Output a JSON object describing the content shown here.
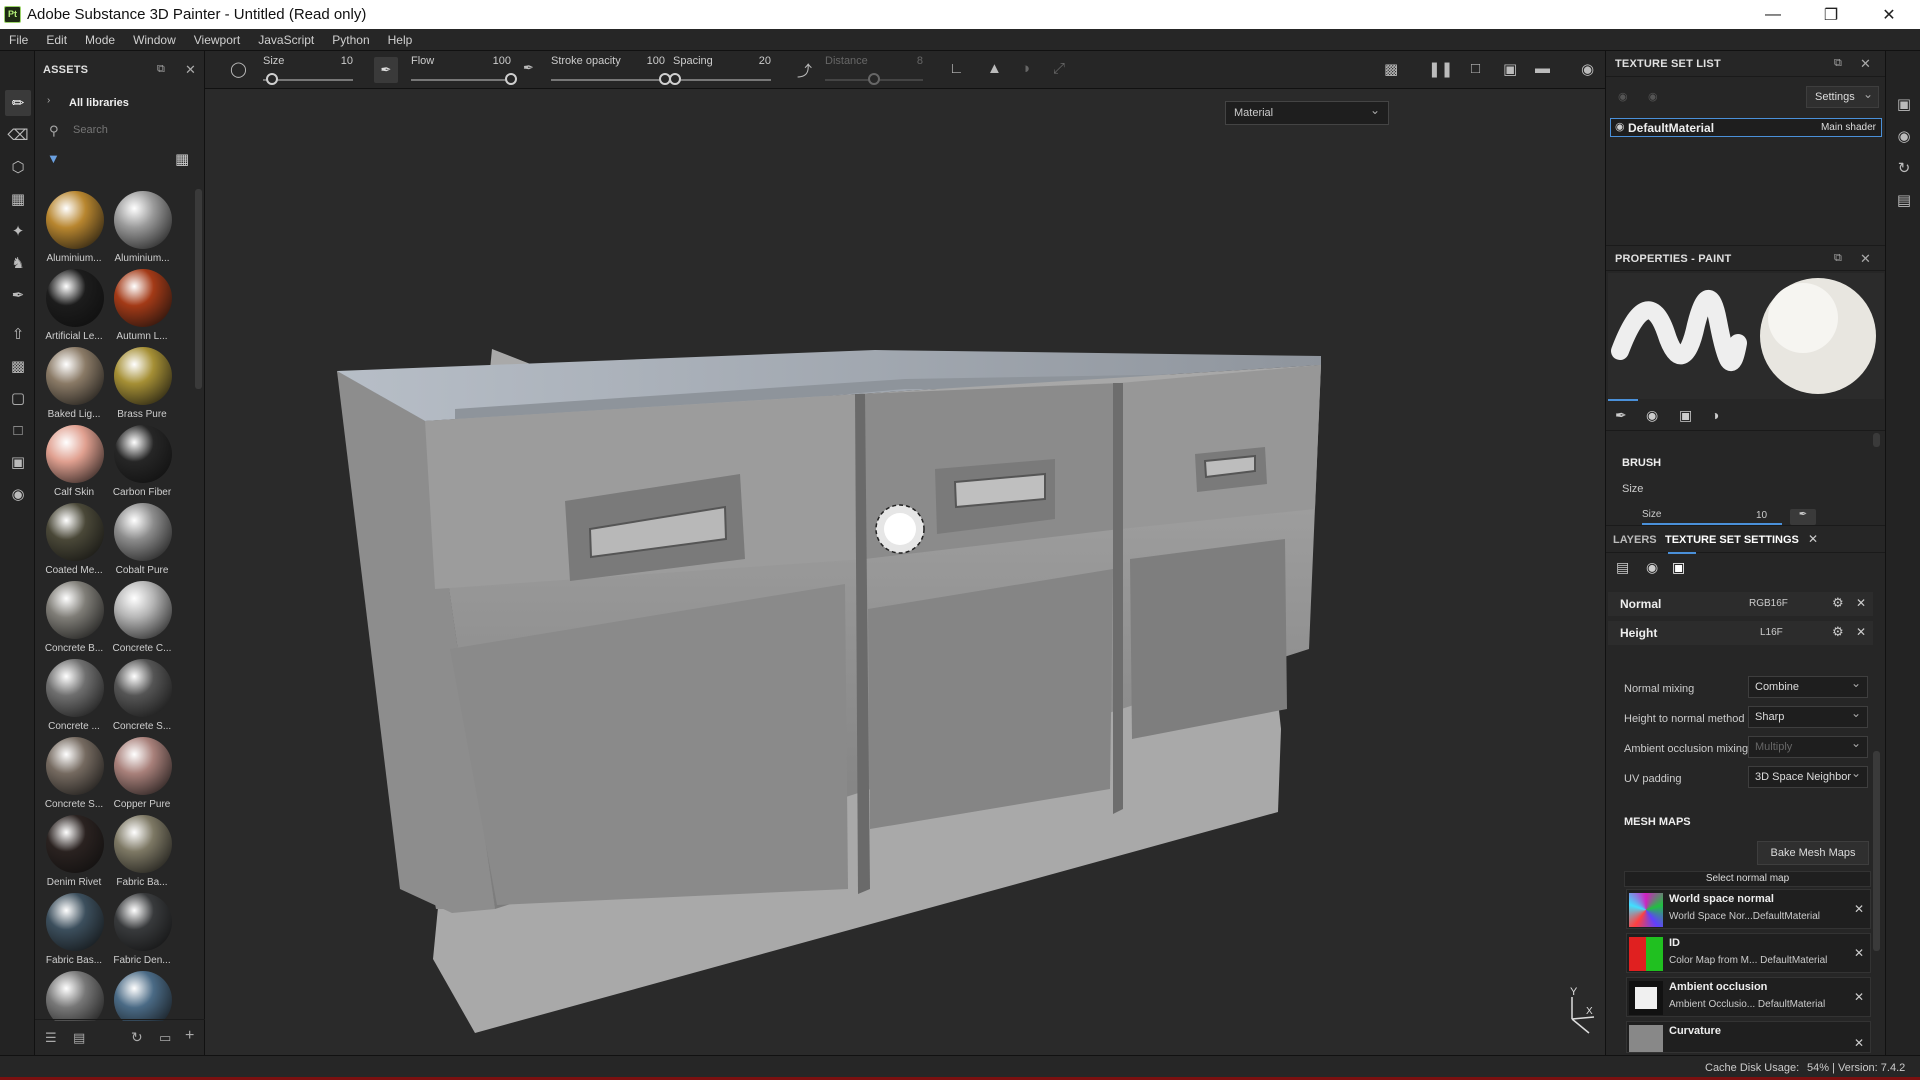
{
  "window": {
    "title": "Adobe Substance 3D Painter - Untitled (Read only)",
    "logo": "Pt"
  },
  "menu": [
    "File",
    "Edit",
    "Mode",
    "Window",
    "Viewport",
    "JavaScript",
    "Python",
    "Help"
  ],
  "tools": [
    "paint-brush",
    "eraser",
    "projection",
    "polygon-fill",
    "smudge",
    "clone",
    "color-picker",
    "bake",
    "geometry-mask",
    "quick-mask",
    "assets",
    "measure",
    "viewer-settings",
    "shelf"
  ],
  "assets_panel": {
    "title": "ASSETS",
    "libraries_label": "All libraries",
    "search_placeholder": "Search",
    "items": [
      {
        "label": "Aluminium...",
        "color": "#b8862f"
      },
      {
        "label": "Aluminium...",
        "color": "#9a9a9a"
      },
      {
        "label": "Artificial Le...",
        "color": "#1c1c1c"
      },
      {
        "label": "Autumn L...",
        "color": "#a33a17"
      },
      {
        "label": "Baked Lig...",
        "color": "#8a7a66"
      },
      {
        "label": "Brass Pure",
        "color": "#a58f35"
      },
      {
        "label": "Calf Skin",
        "color": "#e0a090"
      },
      {
        "label": "Carbon Fiber",
        "color": "#262626"
      },
      {
        "label": "Coated Me...",
        "color": "#4a4838"
      },
      {
        "label": "Cobalt Pure",
        "color": "#8c8c8c"
      },
      {
        "label": "Concrete B...",
        "color": "#7f7d77"
      },
      {
        "label": "Concrete C...",
        "color": "#b5b5b5"
      },
      {
        "label": "Concrete ...",
        "color": "#6f6f6f"
      },
      {
        "label": "Concrete S...",
        "color": "#555555"
      },
      {
        "label": "Concrete S...",
        "color": "#756a60"
      },
      {
        "label": "Copper Pure",
        "color": "#a8807a"
      },
      {
        "label": "Denim Rivet",
        "color": "#2a2220"
      },
      {
        "label": "Fabric Ba...",
        "color": "#7d7864"
      },
      {
        "label": "Fabric Bas...",
        "color": "#3c4f5d"
      },
      {
        "label": "Fabric Den...",
        "color": "#383a3c"
      },
      {
        "label": "",
        "color": "#777777"
      },
      {
        "label": "",
        "color": "#4a6a85"
      }
    ]
  },
  "toolbar": {
    "size": {
      "label": "Size",
      "value": "10",
      "fraction": 0.1
    },
    "flow": {
      "label": "Flow",
      "value": "100",
      "fraction": 1.0
    },
    "stroke_opacity": {
      "label": "Stroke opacity",
      "value": "100",
      "fraction": 1.0
    },
    "spacing": {
      "label": "Spacing",
      "value": "20",
      "fraction": 0.02
    },
    "distance": {
      "label": "Distance",
      "value": "8",
      "fraction": 0.5
    }
  },
  "viewport": {
    "material_mode": "Material",
    "axis_y": "Y",
    "axis_x": "X"
  },
  "texture_set_list": {
    "title": "TEXTURE SET LIST",
    "settings_label": "Settings",
    "item_name": "DefaultMaterial",
    "item_shader": "Main shader"
  },
  "properties": {
    "title": "PROPERTIES - PAINT",
    "section": "BRUSH",
    "size_group": "Size",
    "size_label": "Size",
    "size_value": "10",
    "size_fraction": 0.1
  },
  "bottom_tabs": {
    "layers": "LAYERS",
    "tss": "TEXTURE SET SETTINGS"
  },
  "channels": [
    {
      "name": "Normal",
      "format": "RGB16F"
    },
    {
      "name": "Height",
      "format": "L16F"
    }
  ],
  "settings": [
    {
      "label": "Normal mixing",
      "value": "Combine",
      "disabled": false
    },
    {
      "label": "Height to normal method",
      "value": "Sharp",
      "disabled": false
    },
    {
      "label": "Ambient occlusion mixing",
      "value": "Multiply",
      "disabled": true
    },
    {
      "label": "UV padding",
      "value": "3D Space Neighbor",
      "disabled": false
    }
  ],
  "mesh_maps": {
    "title": "MESH MAPS",
    "bake_label": "Bake Mesh Maps",
    "select_normal_label": "Select normal map",
    "maps": [
      {
        "name": "World space normal",
        "detail": "World Space Nor...DefaultMaterial"
      },
      {
        "name": "ID",
        "detail": "Color Map from M... DefaultMaterial"
      },
      {
        "name": "Ambient occlusion",
        "detail": "Ambient Occlusio... DefaultMaterial"
      },
      {
        "name": "Curvature",
        "detail": ""
      }
    ]
  },
  "status": {
    "cache": "Cache Disk Usage:",
    "usage": "54% | Version: 7.4.2"
  },
  "colors": {
    "accent": "#4a90d9",
    "panel": "#262626",
    "viewport": "#2a2a2a"
  }
}
